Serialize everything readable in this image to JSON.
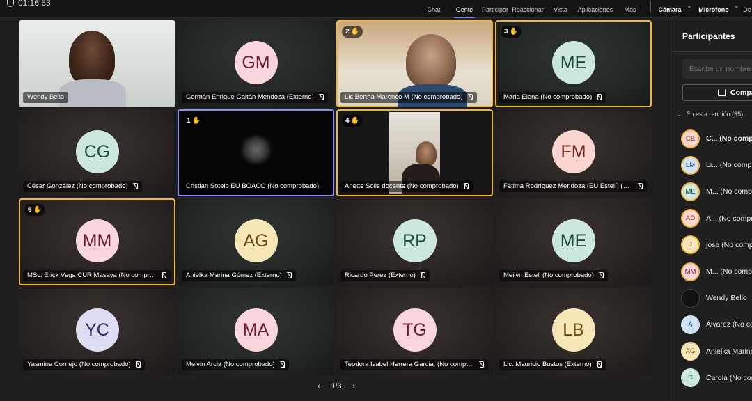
{
  "topbar": {
    "timer": "01:16:53",
    "items": [
      "Chat",
      "Gente",
      "Participar",
      "Reaccionar",
      "Vista",
      "Aplicaciones",
      "Más"
    ],
    "active": "Gente",
    "camera": "Cámara",
    "mic": "Micrófono",
    "more_cut": "De"
  },
  "tiles": [
    {
      "name": "Wendy Bello",
      "initials": "",
      "video": true
    },
    {
      "name": "Germán Enrique Gaitán Mendoza (Externo)",
      "initials": "GM",
      "av_bg": "#f9d5dc",
      "av_fg": "#6d1c2f"
    },
    {
      "name": "Lic.Bertha Marenco M (No comprobado)",
      "initials": "",
      "hand": "2",
      "video": true
    },
    {
      "name": "Maria Elena (No comprobado)",
      "initials": "ME",
      "hand": "3",
      "av_bg": "#cce8de",
      "av_fg": "#1f4d3d"
    },
    {
      "name": "César González (No comprobado)",
      "initials": "CG",
      "av_bg": "#cce8de",
      "av_fg": "#1f4d3d"
    },
    {
      "name": "Cristian Sotelo EU BOACO (No comprobado)",
      "initials": "",
      "hand": "1",
      "video": true
    },
    {
      "name": "Anette Solis docente (No comprobado)",
      "initials": "",
      "hand": "4",
      "video": true
    },
    {
      "name": "Fátima Rodríguez Mendoza (EU Estelí) (No comprobado)",
      "initials": "FM",
      "av_bg": "#fbd5cf",
      "av_fg": "#7a2a1e"
    },
    {
      "name": "MSc. Erick Vega CUR Masaya (No comprobado)",
      "initials": "MM",
      "hand": "6",
      "av_bg": "#f9d5dc",
      "av_fg": "#6d1c2f"
    },
    {
      "name": "Anielka Marina Gómez (Externo)",
      "initials": "AG",
      "av_bg": "#f7e6b8",
      "av_fg": "#6b4c0c"
    },
    {
      "name": "Ricardo Perez (Externo)",
      "initials": "RP",
      "av_bg": "#cce8de",
      "av_fg": "#1f4d3d"
    },
    {
      "name": "Meilyn Esteli (No comprobado)",
      "initials": "ME",
      "av_bg": "#cce8de",
      "av_fg": "#1f4d3d"
    },
    {
      "name": "Yasmina Cornejo (No comprobado)",
      "initials": "YC",
      "av_bg": "#dcdcf2",
      "av_fg": "#2f2f6a"
    },
    {
      "name": "Melvin Arcia (No comprobado)",
      "initials": "MA",
      "av_bg": "#f9d5dc",
      "av_fg": "#6d1c2f"
    },
    {
      "name": "Teodora Isabel Herrera Garcia. (No comprobado)",
      "initials": "TG",
      "av_bg": "#f9d5dc",
      "av_fg": "#6d1c2f"
    },
    {
      "name": "Lic. Mauricio Bustos (Externo)",
      "initials": "LB",
      "av_bg": "#f7e6b8",
      "av_fg": "#6b4c0c"
    }
  ],
  "pager": {
    "label": "1/3"
  },
  "panel": {
    "title": "Participantes",
    "search_placeholder": "Escribe un nombre",
    "share_label": "Compartir",
    "meeting_header": "En esta reunión (35)",
    "participants": [
      {
        "initials": "CB",
        "name_bold": "C...",
        "name": "(No comprobado)",
        "av_bg": "#fbd5cf",
        "av_fg": "#7a2a1e",
        "ring": true
      },
      {
        "initials": "LM",
        "name_bold": "",
        "name": "Li... (No comprobado)",
        "av_bg": "#d0e4f5",
        "av_fg": "#1e3f66",
        "ring": true
      },
      {
        "initials": "ME",
        "name_bold": "",
        "name": "M... (No comprobado)",
        "av_bg": "#cce8de",
        "av_fg": "#1f4d3d",
        "ring": true
      },
      {
        "initials": "AD",
        "name_bold": "",
        "name": "A... (No comprobado)",
        "av_bg": "#fbd5cf",
        "av_fg": "#7a2a1e",
        "ring": true
      },
      {
        "initials": "J",
        "name_bold": "",
        "name": "jose (No comprobado)",
        "av_bg": "#f7e6b8",
        "av_fg": "#6b4c0c",
        "ring": true
      },
      {
        "initials": "MM",
        "name_bold": "",
        "name": "M... (No comprobado)",
        "av_bg": "#f9d5dc",
        "av_fg": "#6d1c2f",
        "ring": true
      },
      {
        "initials": "",
        "name_bold": "",
        "name": "Wendy Bello",
        "av_bg": "#111111",
        "av_fg": "#ffffff",
        "ring": false
      },
      {
        "initials": "Á",
        "name_bold": "",
        "name": "Álvarez (No comprobado)",
        "av_bg": "#d0e4f5",
        "av_fg": "#1e3f66",
        "ring": false
      },
      {
        "initials": "AG",
        "name_bold": "",
        "name": "Anielka Marina Gómez",
        "av_bg": "#f7e6b8",
        "av_fg": "#6b4c0c",
        "ring": false
      },
      {
        "initials": "C",
        "name_bold": "",
        "name": "Carola (No comprobado)",
        "av_bg": "#cce8de",
        "av_fg": "#1f4d3d",
        "ring": false
      }
    ]
  }
}
